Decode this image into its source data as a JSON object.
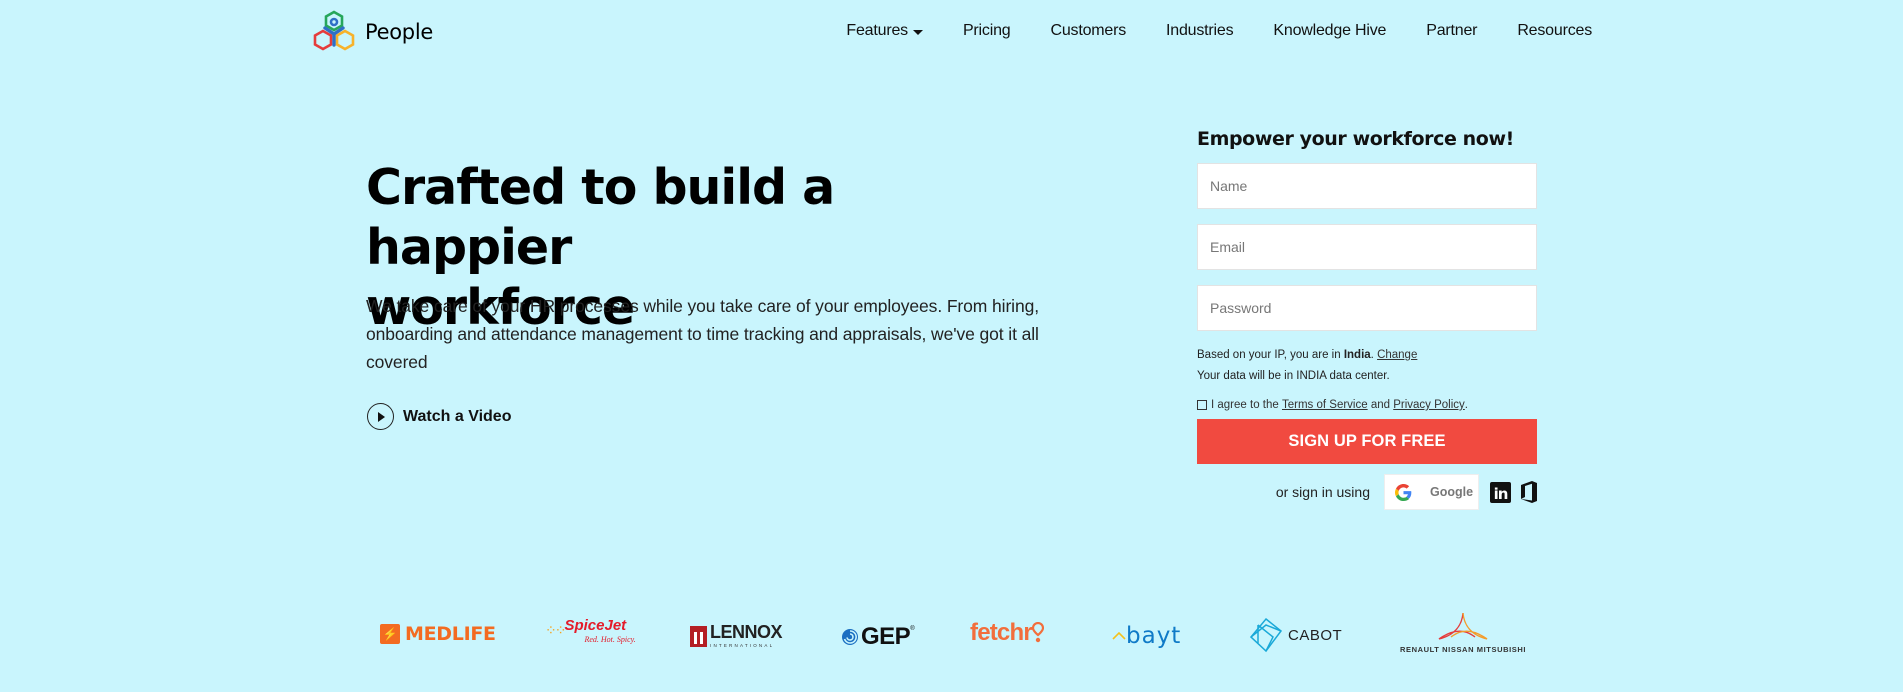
{
  "header": {
    "brand": "People",
    "nav": [
      {
        "label": "Features",
        "has_dropdown": true
      },
      {
        "label": "Pricing"
      },
      {
        "label": "Customers"
      },
      {
        "label": "Industries"
      },
      {
        "label": "Knowledge Hive"
      },
      {
        "label": "Partner"
      },
      {
        "label": "Resources"
      }
    ]
  },
  "hero": {
    "title_line1": "Crafted to build a happier",
    "title_line2": "workforce",
    "description": "We take care of your HR processes while you take care of your employees. From hiring, onboarding and attendance management to time tracking and appraisals, we've got it all covered",
    "video_link": "Watch a Video"
  },
  "signup": {
    "title": "Empower your workforce now!",
    "name_placeholder": "Name",
    "email_placeholder": "Email",
    "password_placeholder": "Password",
    "ip_prefix": "Based on your IP, you are in ",
    "ip_country": "India",
    "ip_suffix": ". ",
    "change_link": "Change",
    "data_center_note": "Your data will be in INDIA data center.",
    "agree_prefix": "I agree to the ",
    "terms_link": "Terms of Service",
    "agree_and": " and ",
    "privacy_link": "Privacy Policy",
    "agree_suffix": ".",
    "submit_label": "SIGN UP FOR FREE",
    "or_text": "or sign in using",
    "google_label": "Google",
    "linkedin_label": "in",
    "accent_color": "#f14a40"
  },
  "clients": {
    "medlife": "MEDLIFE",
    "spicejet": "SpiceJet",
    "spicejet_tagline": "Red. Hot. Spicy.",
    "lennox": "LENNOX",
    "lennox_sub": "INTERNATIONAL",
    "gep": "GEP",
    "fetchr": "fetchr",
    "bayt": "bayt",
    "cabot": "CABOT",
    "rnm": "RENAULT NISSAN MITSUBISHI"
  },
  "theme": {
    "background": "#c9f5fd"
  }
}
